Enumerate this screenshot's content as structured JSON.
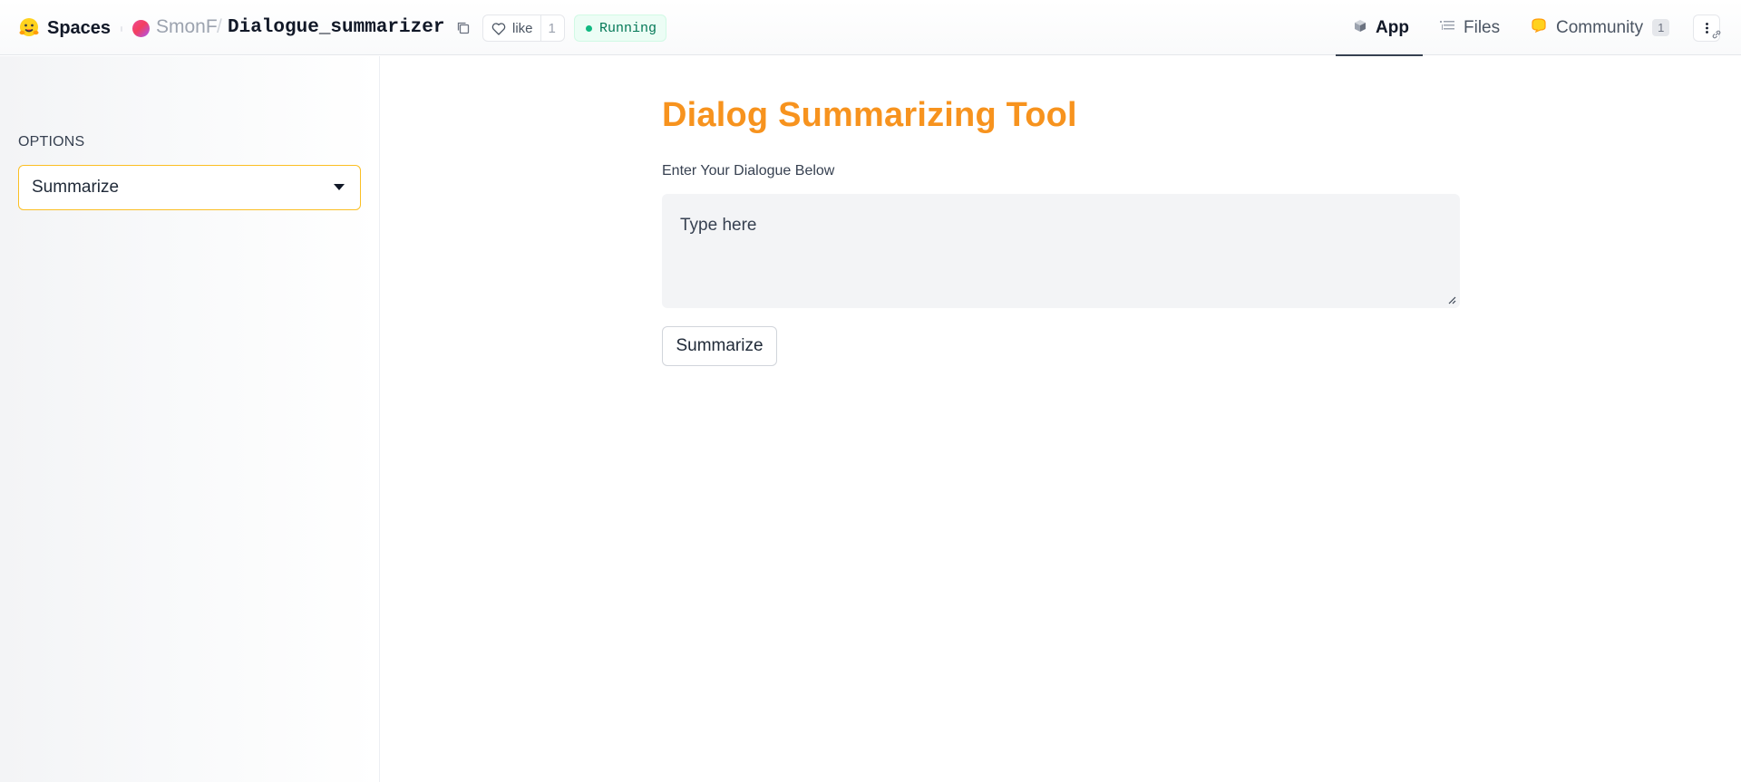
{
  "header": {
    "brand": {
      "label": "Spaces",
      "icon": "hugging-face-logo-icon"
    },
    "repo": {
      "owner": "SmonF",
      "separator": "/",
      "name": "Dialogue_summarizer"
    },
    "like": {
      "label": "like",
      "count": "1"
    },
    "status": {
      "label": "Running",
      "color": "#10b981"
    },
    "tabs": [
      {
        "label": "App",
        "icon": "cube-icon",
        "active": true
      },
      {
        "label": "Files",
        "icon": "files-icon",
        "active": false
      },
      {
        "label": "Community",
        "icon": "community-icon",
        "badge": "1",
        "active": false
      }
    ]
  },
  "sidebar": {
    "options_label": "OPTIONS",
    "select": {
      "value": "Summarize",
      "border_color": "#fbbf24"
    }
  },
  "main": {
    "title": "Dialog Summarizing Tool",
    "title_color": "#f7931e",
    "input_label": "Enter Your Dialogue Below",
    "input_placeholder": "Type here",
    "button_label": "Summarize"
  }
}
